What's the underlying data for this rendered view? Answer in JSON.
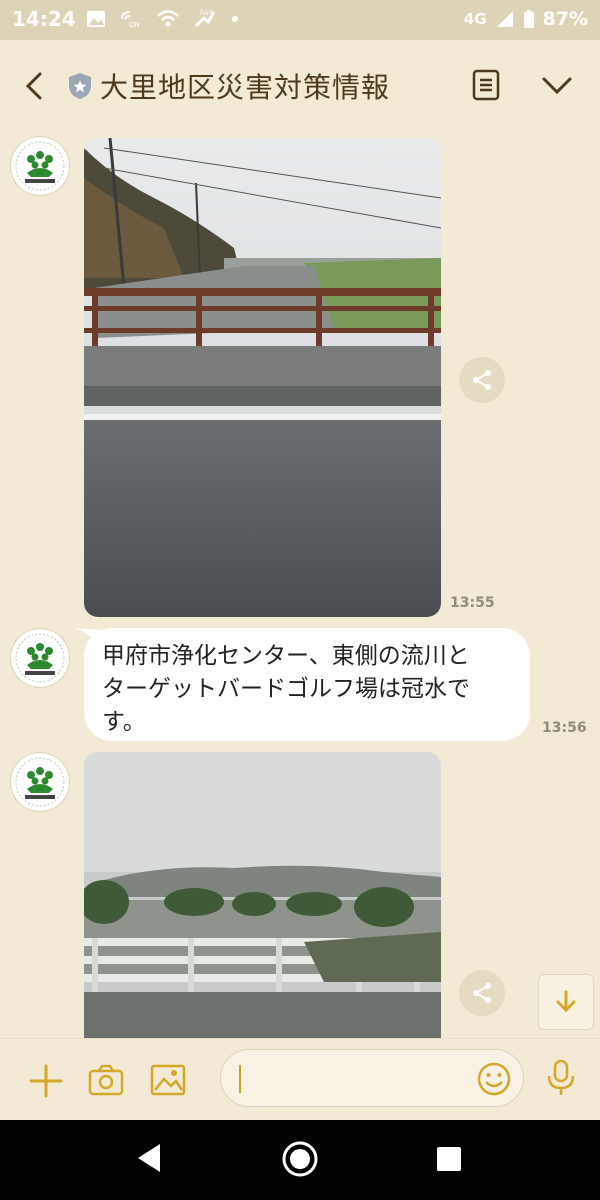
{
  "status_bar": {
    "time": "14:24",
    "network": "4G",
    "battery": "87%"
  },
  "header": {
    "title": "大里地区災害対策情報"
  },
  "messages": [
    {
      "type": "image",
      "timestamp": "13:55"
    },
    {
      "type": "text",
      "text_lines": [
        "甲府市浄化センター、東側の流川と",
        "ターゲットバードゴルフ場は冠水で",
        "す。"
      ],
      "timestamp": "13:56"
    },
    {
      "type": "image"
    }
  ],
  "icons": {
    "back": "chevron-left-icon",
    "shield": "shield-star-icon",
    "notes": "note-icon",
    "menu": "chevron-down-icon",
    "share": "share-icon",
    "scroll_down": "arrow-down-icon",
    "plus": "plus-icon",
    "camera": "camera-icon",
    "image": "image-icon",
    "emoji": "emoji-icon",
    "mic": "mic-icon"
  },
  "colors": {
    "background": "#f2ead4",
    "title": "#4d3a1d",
    "accent": "#d4a62a",
    "status_bar": "#ddd3b7"
  },
  "input": {
    "value": "",
    "placeholder": ""
  }
}
